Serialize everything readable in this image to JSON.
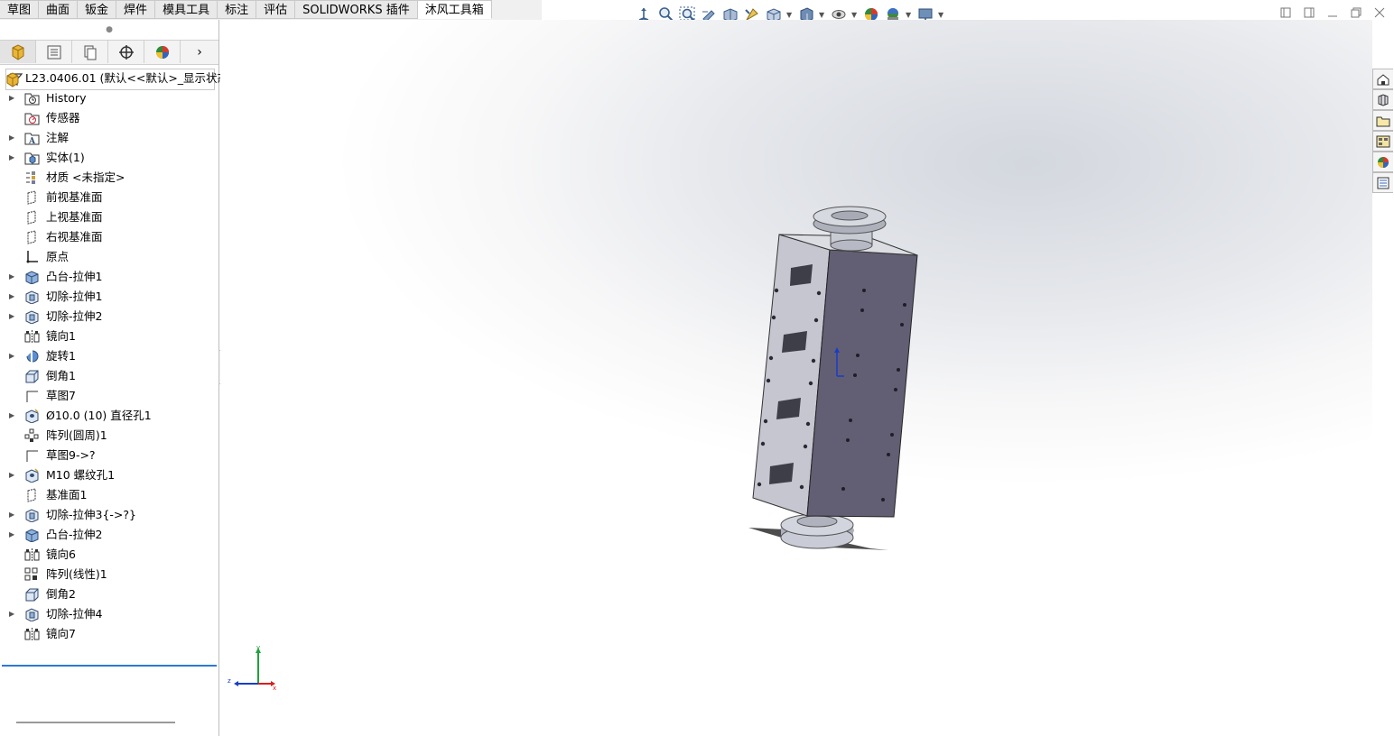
{
  "tabs": [
    {
      "label": "草图"
    },
    {
      "label": "曲面"
    },
    {
      "label": "钣金"
    },
    {
      "label": "焊件"
    },
    {
      "label": "模具工具"
    },
    {
      "label": "标注"
    },
    {
      "label": "评估"
    },
    {
      "label": "SOLIDWORKS 插件"
    },
    {
      "label": "沐风工具箱"
    }
  ],
  "active_tab": "沐风工具箱",
  "hud_icons": [
    "view-orientation-icon",
    "zoom-to-fit-icon",
    "zoom-to-area-icon",
    "previous-view-icon",
    "section-view-icon",
    "dynamic-annotation-icon",
    "view-setting-icon",
    "display-style-icon",
    "hide-show-items-icon",
    "edit-appearance-icon",
    "apply-scene-icon",
    "view-settings-monitor-icon"
  ],
  "window_controls": [
    "restore-left-icon",
    "restore-right-icon",
    "minimize-icon",
    "maximize-icon",
    "close-icon"
  ],
  "panel_tabs": [
    "feature-manager-icon",
    "property-manager-icon",
    "configuration-manager-icon",
    "dimxpert-manager-icon",
    "display-manager-icon"
  ],
  "panel_more": "›",
  "tree": {
    "root": "L23.0406.01  (默认<<默认>_显示状态",
    "items": [
      {
        "label": "History",
        "icon": "history-folder-icon",
        "expandable": true
      },
      {
        "label": "传感器",
        "icon": "sensors-icon",
        "expandable": false
      },
      {
        "label": "注解",
        "icon": "annotations-icon",
        "expandable": true
      },
      {
        "label": "实体(1)",
        "icon": "solid-bodies-icon",
        "expandable": true
      },
      {
        "label": "材质 <未指定>",
        "icon": "material-icon",
        "expandable": false
      },
      {
        "label": "前视基准面",
        "icon": "plane-icon",
        "expandable": false
      },
      {
        "label": "上视基准面",
        "icon": "plane-icon",
        "expandable": false
      },
      {
        "label": "右视基准面",
        "icon": "plane-icon",
        "expandable": false
      },
      {
        "label": "原点",
        "icon": "origin-icon",
        "expandable": false
      },
      {
        "label": "凸台-拉伸1",
        "icon": "boss-extrude-icon",
        "expandable": true
      },
      {
        "label": "切除-拉伸1",
        "icon": "cut-extrude-icon",
        "expandable": true
      },
      {
        "label": "切除-拉伸2",
        "icon": "cut-extrude-icon",
        "expandable": true
      },
      {
        "label": "镜向1",
        "icon": "mirror-icon",
        "expandable": false
      },
      {
        "label": "旋转1",
        "icon": "revolve-icon",
        "expandable": true
      },
      {
        "label": "倒角1",
        "icon": "chamfer-icon",
        "expandable": false
      },
      {
        "label": "草图7",
        "icon": "sketch-icon",
        "expandable": false
      },
      {
        "label": "Ø10.0 (10) 直径孔1",
        "icon": "hole-icon",
        "expandable": true
      },
      {
        "label": "阵列(圆周)1",
        "icon": "circular-pattern-icon",
        "expandable": false
      },
      {
        "label": "草图9->?",
        "icon": "sketch-icon",
        "expandable": false
      },
      {
        "label": "M10 螺纹孔1",
        "icon": "hole-icon",
        "expandable": true
      },
      {
        "label": "基准面1",
        "icon": "plane-icon",
        "expandable": false
      },
      {
        "label": "切除-拉伸3{->?}",
        "icon": "cut-extrude-icon",
        "expandable": true
      },
      {
        "label": "凸台-拉伸2",
        "icon": "boss-extrude-icon",
        "expandable": true
      },
      {
        "label": "镜向6",
        "icon": "mirror-icon",
        "expandable": false
      },
      {
        "label": "阵列(线性)1",
        "icon": "linear-pattern-icon",
        "expandable": false
      },
      {
        "label": "倒角2",
        "icon": "chamfer-icon",
        "expandable": false
      },
      {
        "label": "切除-拉伸4",
        "icon": "cut-extrude-icon",
        "expandable": true
      },
      {
        "label": "镜向7",
        "icon": "mirror-icon",
        "expandable": false
      }
    ]
  },
  "task_pane": [
    "solidworks-resources-icon",
    "design-library-icon",
    "file-explorer-icon",
    "view-palette-icon",
    "appearances-icon",
    "custom-properties-icon"
  ],
  "triad": {
    "x": "x",
    "y": "y",
    "z": "z"
  },
  "colors": {
    "accent": "#2b79d6",
    "model_face": "#6b6878",
    "model_side": "#c2c2cc"
  }
}
